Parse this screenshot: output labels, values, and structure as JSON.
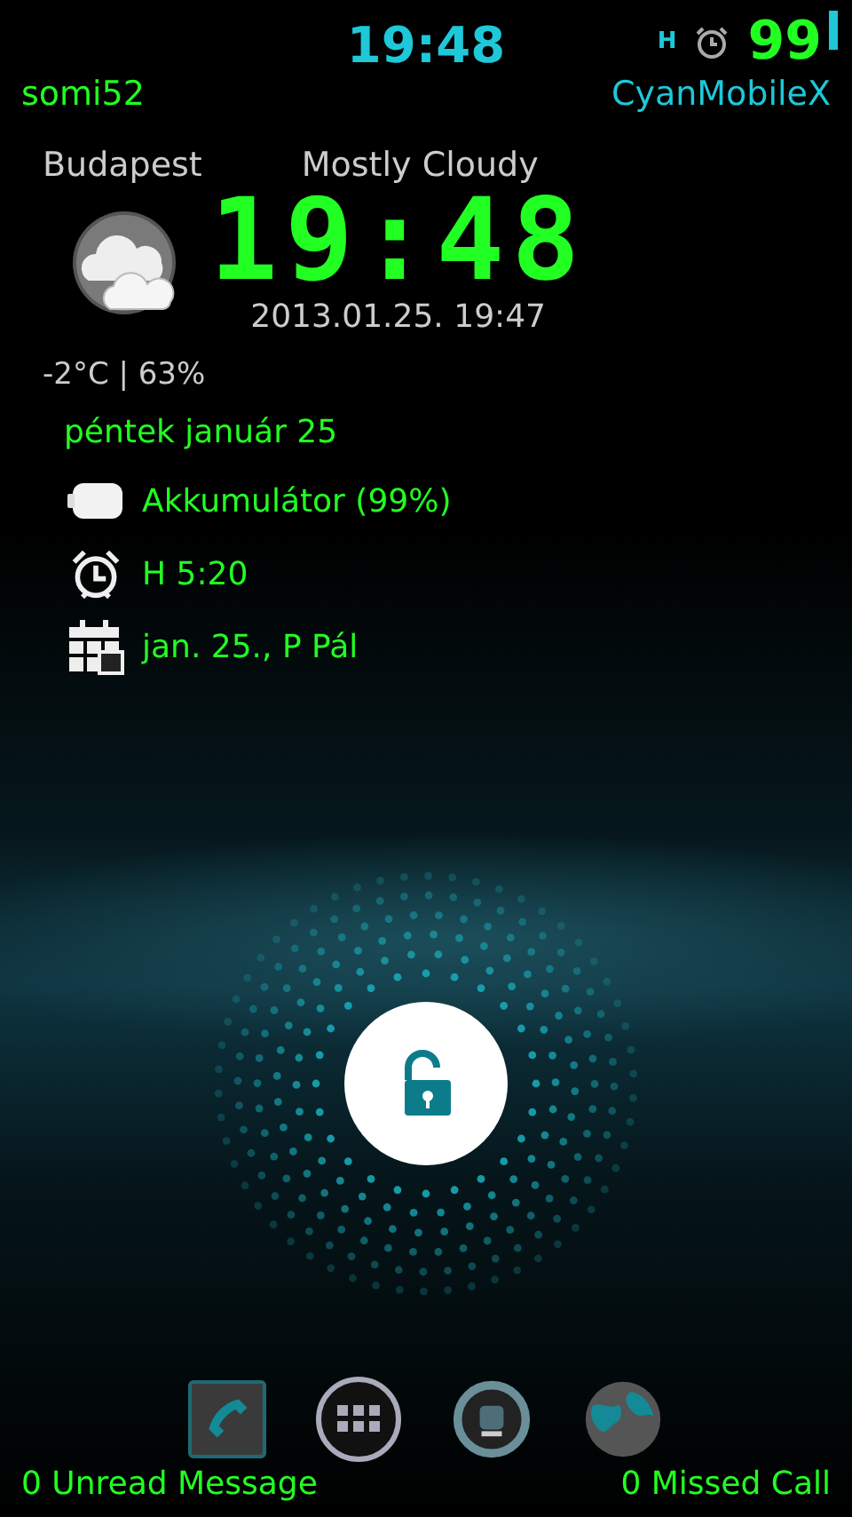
{
  "status_bar": {
    "time": "19:48",
    "network": "H",
    "battery_percent": "99"
  },
  "header": {
    "owner": "somi52",
    "rom": "CyanMobileX"
  },
  "weather": {
    "city": "Budapest",
    "condition": "Mostly Cloudy",
    "temp_humidity": "-2°C | 63%"
  },
  "clock": {
    "time": "19:48",
    "updated": "2013.01.25. 19:47"
  },
  "date": "péntek január 25",
  "info_rows": [
    {
      "kind": "battery",
      "text": "Akkumulátor (99%)"
    },
    {
      "kind": "alarm",
      "text": "H 5:20"
    },
    {
      "kind": "calendar",
      "text": "jan. 25., P Pál"
    }
  ],
  "footer": {
    "messages": "0 Unread Message",
    "calls": "0 Missed Call"
  }
}
